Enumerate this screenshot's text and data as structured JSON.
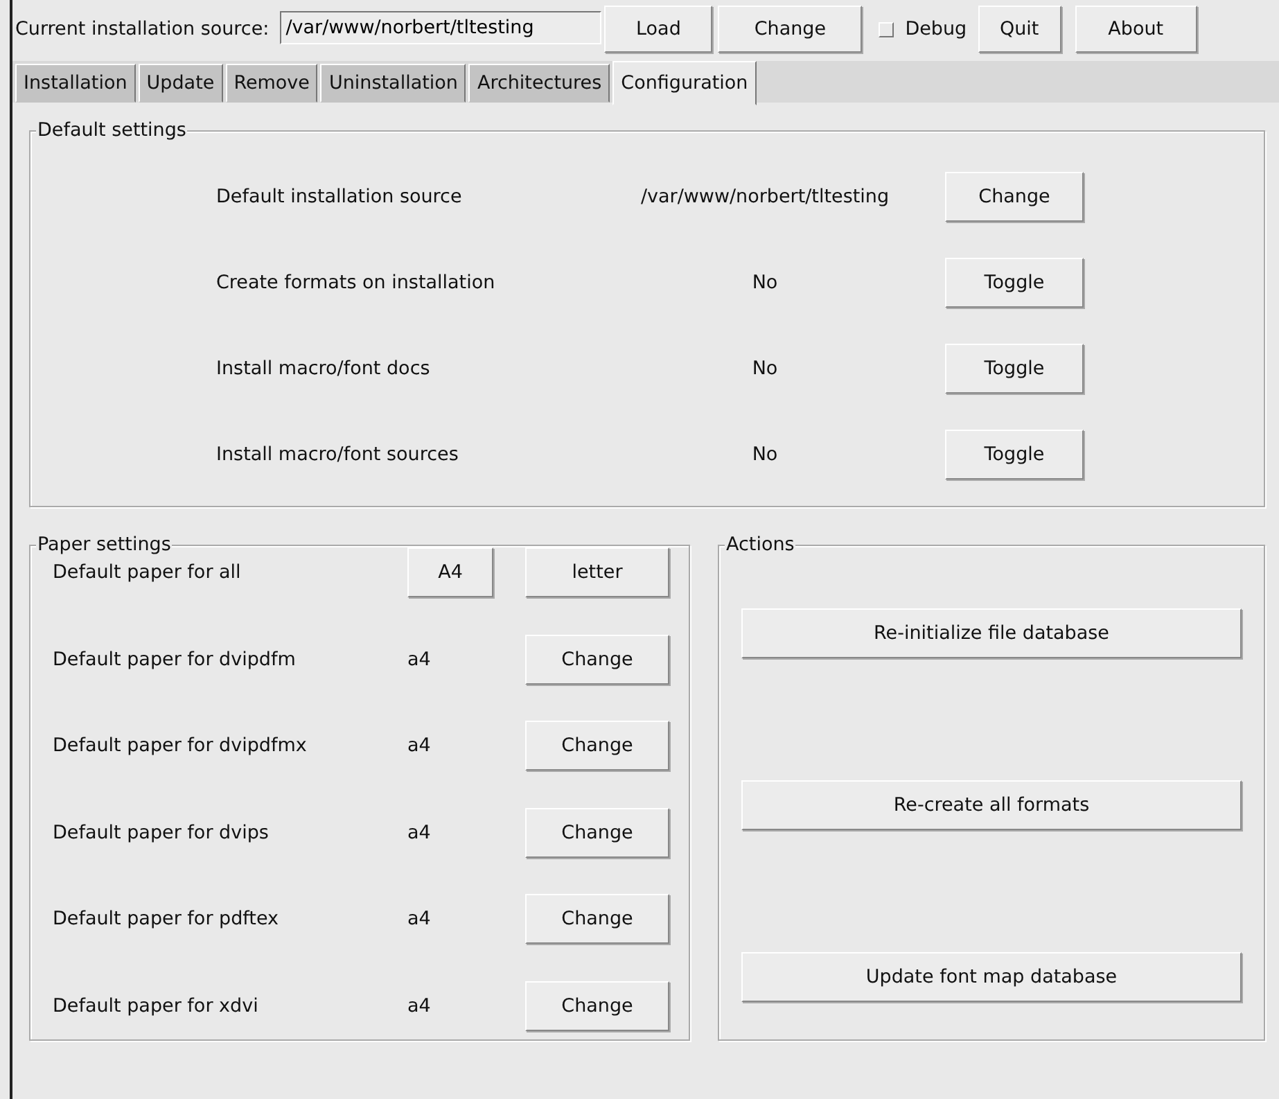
{
  "toolbar": {
    "source_label": "Current installation source:",
    "source_value": "/var/www/norbert/tltesting",
    "buttons": [
      "Load",
      "Change"
    ],
    "debug": {
      "label": "Debug",
      "checked": false
    },
    "buttons_right": [
      "Quit",
      "About"
    ]
  },
  "tabs": [
    {
      "label": "Installation",
      "selected": false
    },
    {
      "label": "Update",
      "selected": false
    },
    {
      "label": "Remove",
      "selected": false
    },
    {
      "label": "Uninstallation",
      "selected": false
    },
    {
      "label": "Architectures",
      "selected": false
    },
    {
      "label": "Configuration",
      "selected": true
    }
  ],
  "default_settings": {
    "title": "Default settings",
    "rows": [
      {
        "label": "Default installation source",
        "value": "/var/www/norbert/tltesting",
        "button": "Change"
      },
      {
        "label": "Create formats on installation",
        "value": "No",
        "button": "Toggle"
      },
      {
        "label": "Install macro/font docs",
        "value": "No",
        "button": "Toggle"
      },
      {
        "label": "Install macro/font sources",
        "value": "No",
        "button": "Toggle"
      }
    ]
  },
  "paper_settings": {
    "title": "Paper settings",
    "rows": [
      {
        "kind": "all",
        "label": "Default paper for all",
        "buttons": [
          "A4",
          "letter"
        ]
      },
      {
        "kind": "single",
        "label": "Default paper for dvipdfm",
        "value": "a4",
        "button": "Change"
      },
      {
        "kind": "single",
        "label": "Default paper for dvipdfmx",
        "value": "a4",
        "button": "Change"
      },
      {
        "kind": "single",
        "label": "Default paper for dvips",
        "value": "a4",
        "button": "Change"
      },
      {
        "kind": "single",
        "label": "Default paper for pdftex",
        "value": "a4",
        "button": "Change"
      },
      {
        "kind": "single",
        "label": "Default paper for xdvi",
        "value": "a4",
        "button": "Change"
      }
    ]
  },
  "actions": {
    "title": "Actions",
    "buttons": [
      "Re-initialize file database",
      "Re-create all formats",
      "Update font map database"
    ]
  }
}
